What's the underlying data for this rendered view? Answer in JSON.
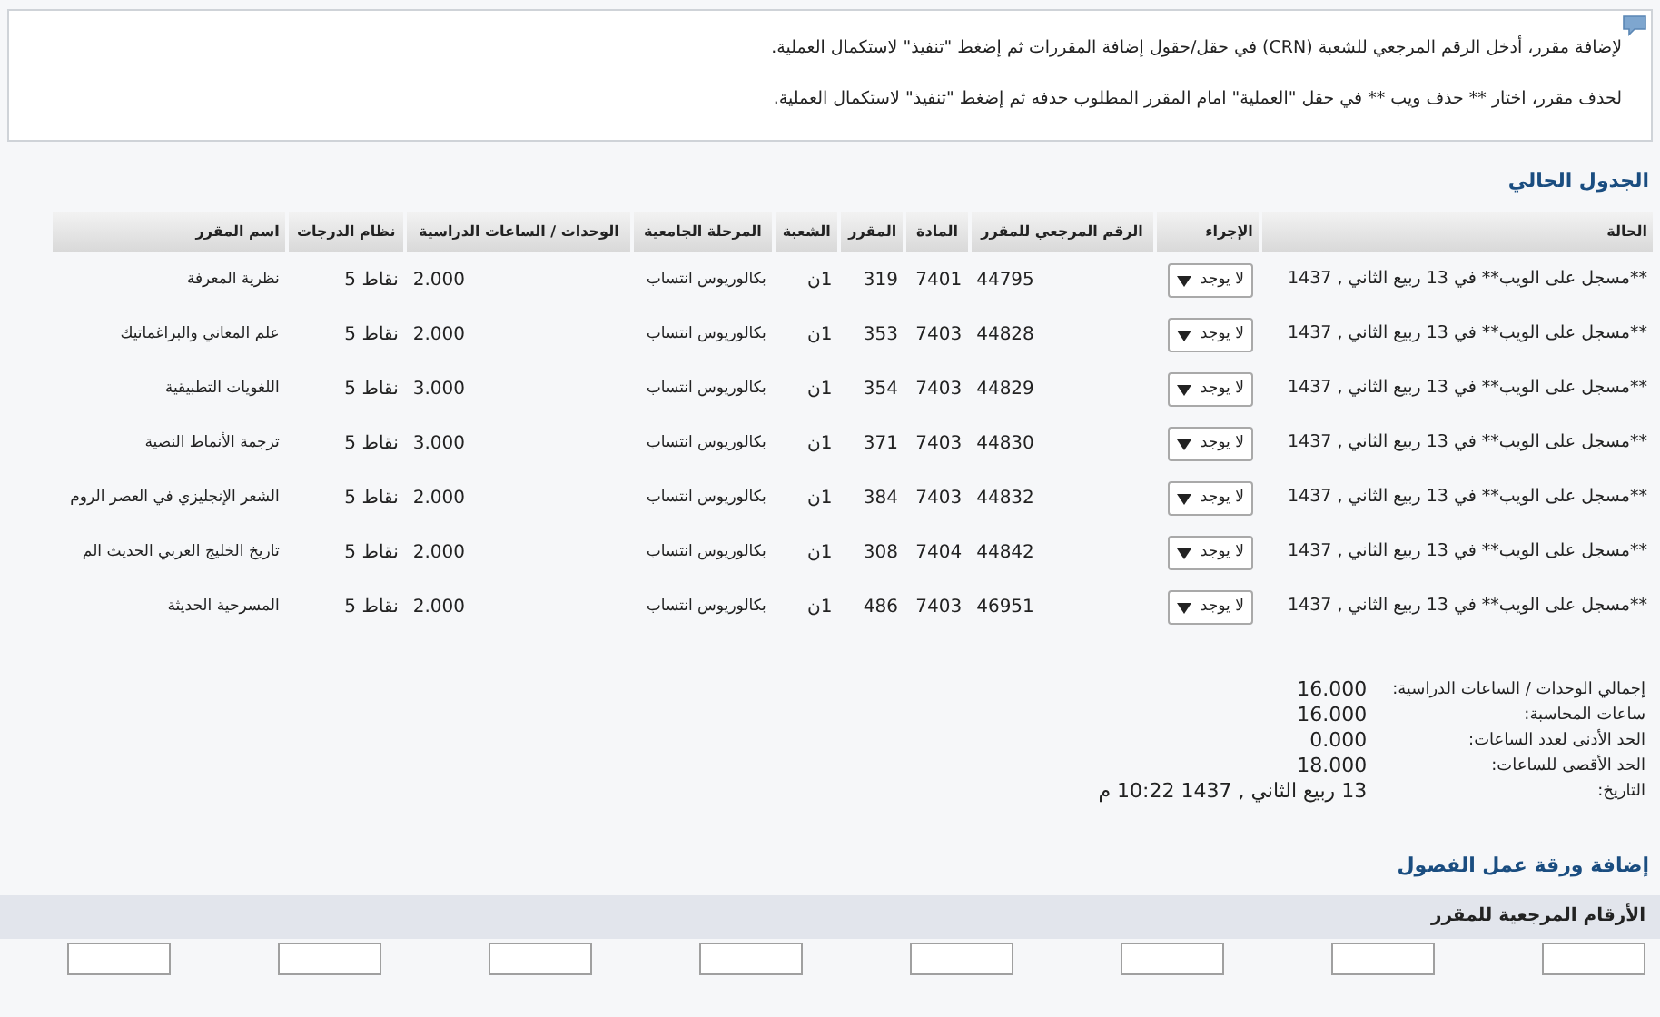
{
  "info_box": {
    "lines": [
      "لإضافة مقرر، أدخل الرقم المرجعي للشعبة (CRN) في حقل/حقول إضافة المقررات ثم إضغط \"تنفيذ\" لاستكمال العملية.",
      "لحذف مقرر، اختار ** حذف ويب ** في حقل \"العملية\" امام المقرر المطلوب حذفه ثم إضغط \"تنفيذ\" لاستكمال العملية."
    ]
  },
  "schedule": {
    "title": "الجدول الحالي",
    "columns": [
      "الحالة",
      "الإجراء",
      "الرقم المرجعي للمقرر",
      "المادة",
      "المقرر",
      "الشعبة",
      "المرحلة الجامعية",
      "الوحدات / الساعات الدراسية",
      "نظام الدرجات",
      "اسم المقرر"
    ],
    "rows": [
      {
        "status": "**مسجل على الويب** في 13 ربيع الثاني , 1437",
        "action": "لا يوجد",
        "crn": "44795",
        "subject": "7401",
        "course": "319",
        "section": "1ن",
        "level": "بكالوريوس انتساب",
        "hours": "2.000",
        "grading": "نقاط 5",
        "name": "نظرية المعرفة"
      },
      {
        "status": "**مسجل على الويب** في 13 ربيع الثاني , 1437",
        "action": "لا يوجد",
        "crn": "44828",
        "subject": "7403",
        "course": "353",
        "section": "1ن",
        "level": "بكالوريوس انتساب",
        "hours": "2.000",
        "grading": "نقاط 5",
        "name": "علم المعاني والبراغماتيك"
      },
      {
        "status": "**مسجل على الويب** في 13 ربيع الثاني , 1437",
        "action": "لا يوجد",
        "crn": "44829",
        "subject": "7403",
        "course": "354",
        "section": "1ن",
        "level": "بكالوريوس انتساب",
        "hours": "3.000",
        "grading": "نقاط 5",
        "name": "اللغويات التطبيقية"
      },
      {
        "status": "**مسجل على الويب** في 13 ربيع الثاني , 1437",
        "action": "لا يوجد",
        "crn": "44830",
        "subject": "7403",
        "course": "371",
        "section": "1ن",
        "level": "بكالوريوس انتساب",
        "hours": "3.000",
        "grading": "نقاط 5",
        "name": "ترجمة الأنماط النصية"
      },
      {
        "status": "**مسجل على الويب** في 13 ربيع الثاني , 1437",
        "action": "لا يوجد",
        "crn": "44832",
        "subject": "7403",
        "course": "384",
        "section": "1ن",
        "level": "بكالوريوس انتساب",
        "hours": "2.000",
        "grading": "نقاط 5",
        "name": "الشعر الإنجليزي في العصر الروم"
      },
      {
        "status": "**مسجل على الويب** في 13 ربيع الثاني , 1437",
        "action": "لا يوجد",
        "crn": "44842",
        "subject": "7404",
        "course": "308",
        "section": "1ن",
        "level": "بكالوريوس انتساب",
        "hours": "2.000",
        "grading": "نقاط 5",
        "name": "تاريخ الخليج العربي الحديث الم"
      },
      {
        "status": "**مسجل على الويب** في 13 ربيع الثاني , 1437",
        "action": "لا يوجد",
        "crn": "46951",
        "subject": "7403",
        "course": "486",
        "section": "1ن",
        "level": "بكالوريوس انتساب",
        "hours": "2.000",
        "grading": "نقاط 5",
        "name": "المسرحية الحديثة"
      }
    ]
  },
  "summary": [
    {
      "label": "إجمالي الوحدات / الساعات الدراسية:",
      "value": "16.000"
    },
    {
      "label": "ساعات المحاسبة:",
      "value": "16.000"
    },
    {
      "label": "الحد الأدنى لعدد الساعات:",
      "value": "0.000"
    },
    {
      "label": "الحد الأقصى للساعات:",
      "value": "18.000"
    },
    {
      "label": "التاريخ:",
      "value": "13 ربيع الثاني , 1437 10:22 م"
    }
  ],
  "add_worksheet": {
    "title": "إضافة ورقة عمل الفصول",
    "band_label": "الأرقام المرجعية للمقرر",
    "crn_inputs": [
      {
        "disabled": false
      },
      {
        "disabled": false
      },
      {
        "disabled": false
      },
      {
        "disabled": false
      },
      {
        "disabled": false
      },
      {
        "disabled": false
      },
      {
        "disabled": false
      },
      {
        "disabled": false
      }
    ]
  }
}
